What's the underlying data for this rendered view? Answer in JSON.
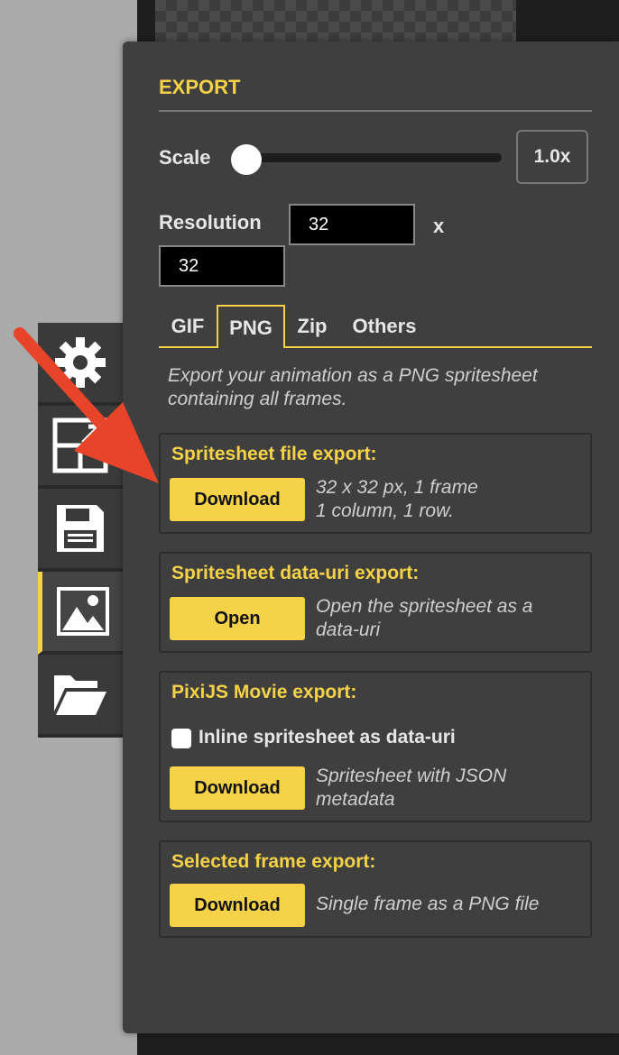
{
  "export_panel": {
    "title": "EXPORT",
    "scale": {
      "label": "Scale",
      "value_display": "1.0x",
      "level": 0.0
    },
    "resolution": {
      "label": "Resolution",
      "width": "32",
      "height": "32",
      "separator": "x"
    },
    "tabs": [
      {
        "label": "GIF",
        "active": false
      },
      {
        "label": "PNG",
        "active": true
      },
      {
        "label": "Zip",
        "active": false
      },
      {
        "label": "Others",
        "active": false
      }
    ],
    "intro": "Export your animation as a PNG spritesheet containing all frames.",
    "sections": {
      "spritesheet_file": {
        "title": "Spritesheet file export:",
        "button": "Download",
        "desc_line1": "32 x 32 px, 1 frame",
        "desc_line2": "1 column, 1 row."
      },
      "data_uri": {
        "title": "Spritesheet data-uri export:",
        "button": "Open",
        "desc_line1": "Open the spritesheet as a",
        "desc_line2": "data-uri"
      },
      "pixijs": {
        "title": "PixiJS Movie export:",
        "checkbox_label": "Inline spritesheet as data-uri",
        "checkbox_checked": false,
        "button": "Download",
        "desc_line1": "Spritesheet with JSON",
        "desc_line2": "metadata"
      },
      "selected_frame": {
        "title": "Selected frame export:",
        "button": "Download",
        "desc_line1": "Single frame as a PNG file"
      }
    }
  },
  "side_tabs": [
    {
      "icon": "gear-icon",
      "active": false
    },
    {
      "icon": "resize-icon",
      "active": false
    },
    {
      "icon": "save-icon",
      "active": false
    },
    {
      "icon": "image-icon",
      "active": true
    },
    {
      "icon": "folder-open-icon",
      "active": false
    }
  ],
  "colors": {
    "accent": "#f5d247",
    "panel_bg": "#3f3f3f",
    "annotation_arrow": "#e8442a"
  }
}
